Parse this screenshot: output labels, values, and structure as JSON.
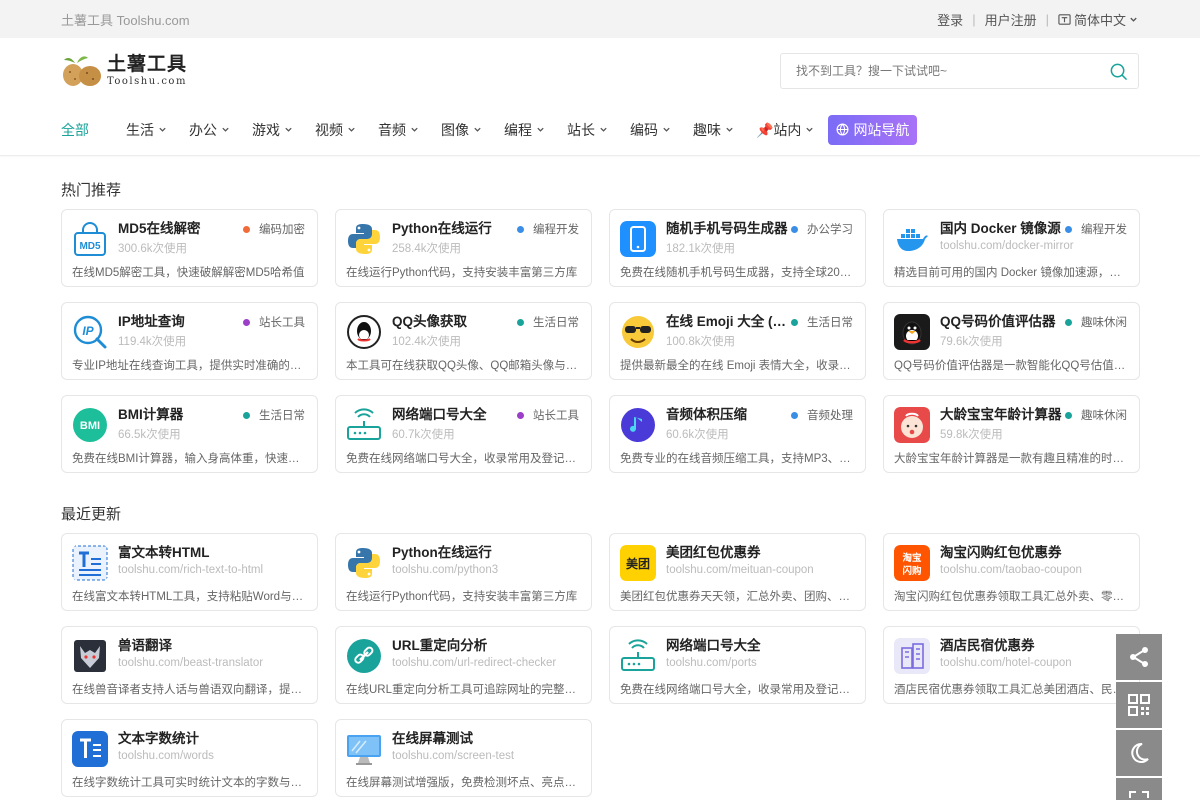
{
  "topbar": {
    "site_name": "土薯工具 Toolshu.com",
    "login": "登录",
    "register": "用户注册",
    "language": "简体中文"
  },
  "header": {
    "logo_title": "土薯工具",
    "logo_sub": "Toolshu.com",
    "search_placeholder": "找不到工具？搜一下试试吧~"
  },
  "nav": {
    "items": [
      "全部",
      "生活",
      "办公",
      "游戏",
      "视频",
      "音频",
      "图像",
      "编程",
      "站长",
      "编码",
      "趣味",
      "📌站内"
    ],
    "site_nav": "网站导航"
  },
  "hot": {
    "title": "热门推荐",
    "cards": [
      {
        "name": "MD5在线解密",
        "tag": "编码加密",
        "tag_color": "#f06a3a",
        "sub": "300.6k次使用",
        "desc": "在线MD5解密工具，快速破解解密MD5哈希值",
        "icon": "md5-icon"
      },
      {
        "name": "Python在线运行",
        "tag": "编程开发",
        "tag_color": "#3a8ee6",
        "sub": "258.4k次使用",
        "desc": "在线运行Python代码，支持安装丰富第三方库",
        "icon": "python-icon"
      },
      {
        "name": "随机手机号码生成器",
        "tag": "办公学习",
        "tag_color": "#3a8ee6",
        "sub": "182.1k次使用",
        "desc": "免费在线随机手机号码生成器，支持全球208个国家",
        "icon": "phone-icon"
      },
      {
        "name": "国内 Docker 镜像源",
        "tag": "编程开发",
        "tag_color": "#3a8ee6",
        "sub": "toolshu.com/docker-mirror",
        "desc": "精选目前可用的国内 Docker 镜像加速源，提供配置",
        "icon": "docker-icon"
      },
      {
        "name": "IP地址查询",
        "tag": "站长工具",
        "tag_color": "#9b3ec8",
        "sub": "119.4k次使用",
        "desc": "专业IP地址在线查询工具，提供实时准确的全球IP",
        "icon": "ip-icon"
      },
      {
        "name": "QQ头像获取",
        "tag": "生活日常",
        "tag_color": "#1aa39a",
        "sub": "102.4k次使用",
        "desc": "本工具可在线获取QQ头像、QQ邮箱头像与QQ昵称",
        "icon": "qq-icon"
      },
      {
        "name": "在线 Emoji 大全 (…",
        "tag": "生活日常",
        "tag_color": "#1aa39a",
        "sub": "100.8k次使用",
        "desc": "提供最新最全的在线 Emoji 表情大全，收录全部",
        "icon": "emoji-icon"
      },
      {
        "name": "QQ号码价值评估器",
        "tag": "趣味休闲",
        "tag_color": "#1aa39a",
        "sub": "79.6k次使用",
        "desc": "QQ号码价值评估器是一款智能化QQ号估值工具",
        "icon": "qq-value-icon"
      },
      {
        "name": "BMI计算器",
        "tag": "生活日常",
        "tag_color": "#1aa39a",
        "sub": "66.5k次使用",
        "desc": "免费在线BMI计算器，输入身高体重，快速计算结果",
        "icon": "bmi-icon"
      },
      {
        "name": "网络端口号大全",
        "tag": "站长工具",
        "tag_color": "#9b3ec8",
        "sub": "60.7k次使用",
        "desc": "免费在线网络端口号大全，收录常用及登记端口号",
        "icon": "router-icon"
      },
      {
        "name": "音频体积压缩",
        "tag": "音频处理",
        "tag_color": "#3a8ee6",
        "sub": "60.6k次使用",
        "desc": "免费专业的在线音频压缩工具，支持MP3、WAV格式",
        "icon": "music-icon"
      },
      {
        "name": "大龄宝宝年龄计算器",
        "tag": "趣味休闲",
        "tag_color": "#1aa39a",
        "sub": "59.8k次使用",
        "desc": "大龄宝宝年龄计算器是一款有趣且精准的时间计算",
        "icon": "baby-icon"
      }
    ]
  },
  "recent": {
    "title": "最近更新",
    "cards": [
      {
        "name": "富文本转HTML",
        "sub": "toolshu.com/rich-text-to-html",
        "desc": "在线富文本转HTML工具，支持粘贴Word与网页内容",
        "icon": "richtext-icon"
      },
      {
        "name": "Python在线运行",
        "sub": "toolshu.com/python3",
        "desc": "在线运行Python代码，支持安装丰富第三方库",
        "icon": "python-icon"
      },
      {
        "name": "美团红包优惠券",
        "sub": "toolshu.com/meituan-coupon",
        "desc": "美团红包优惠券天天领，汇总外卖、团购、闪购红包",
        "icon": "meituan-icon"
      },
      {
        "name": "淘宝闪购红包优惠券",
        "sub": "toolshu.com/taobao-coupon",
        "desc": "淘宝闪购红包优惠券领取工具汇总外卖、零售红包",
        "icon": "taobao-icon"
      },
      {
        "name": "兽语翻译",
        "sub": "toolshu.com/beast-translator",
        "desc": "在线兽音译者支持人话与兽语双向翻译，提供加密",
        "icon": "wolf-icon"
      },
      {
        "name": "URL重定向分析",
        "sub": "toolshu.com/url-redirect-checker",
        "desc": "在线URL重定向分析工具可追踪网址的完整跳转链路",
        "icon": "link-icon"
      },
      {
        "name": "网络端口号大全",
        "sub": "toolshu.com/ports",
        "desc": "免费在线网络端口号大全，收录常用及登记端口号",
        "icon": "router-icon"
      },
      {
        "name": "酒店民宿优惠券",
        "sub": "toolshu.com/hotel-coupon",
        "desc": "酒店民宿优惠券领取工具汇总美团酒店、民宿优惠",
        "icon": "hotel-icon"
      },
      {
        "name": "文本字数统计",
        "sub": "toolshu.com/words",
        "desc": "在线字数统计工具可实时统计文本的字数与字符数",
        "icon": "wordcount-icon"
      },
      {
        "name": "在线屏幕测试",
        "sub": "toolshu.com/screen-test",
        "desc": "在线屏幕测试增强版，免费检测坏点、亮点、漏光",
        "icon": "monitor-icon"
      }
    ]
  },
  "float_tools": [
    "share-icon",
    "qrcode-icon",
    "moon-icon",
    "fullscreen-icon"
  ]
}
